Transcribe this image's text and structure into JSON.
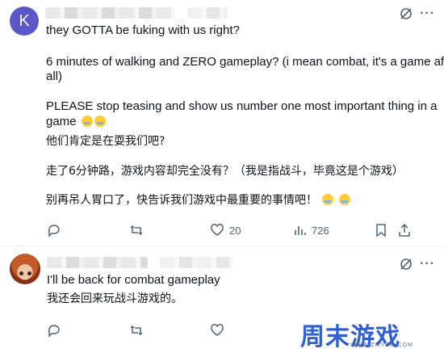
{
  "post1": {
    "avatar_letter": "K",
    "lines_en": [
      "they GOTTA be fuking with us right?",
      "6 minutes of walking and ZERO gameplay? (i mean combat, it's a game after",
      "all)",
      "PLEASE stop teasing and show us number one most important thing in a",
      "game"
    ],
    "lines_zh": [
      "他们肯定是在耍我们吧?",
      "走了6分钟路，游戏内容却完全没有？（我是指战斗，毕竟这是个游戏）",
      "别再吊人胃口了，快告诉我们游戏中最重要的事情吧！"
    ],
    "likes": "20",
    "views": "726"
  },
  "post2": {
    "line_en": "I'll be back for combat gameplay",
    "line_zh": "我还会回来玩战斗游戏的。"
  },
  "watermark": {
    "text": "周末游戏",
    "url": "WWW.ZMYSM.COM"
  },
  "colors": {
    "accent": "#1d9bf0",
    "muted": "#536471",
    "avatar": "#5b57c9",
    "watermark": "#2f5fd0"
  }
}
